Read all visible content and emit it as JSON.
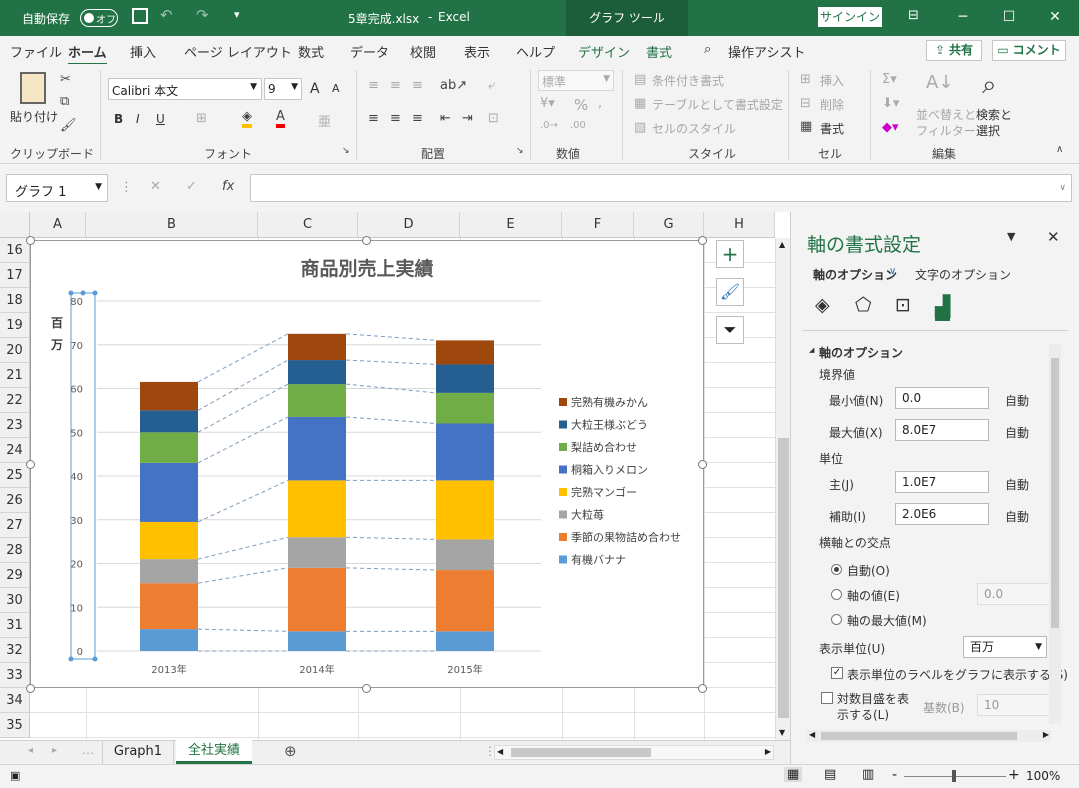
{
  "titlebar": {
    "autosave": "自動保存",
    "toggle": "オフ",
    "filename": "5章完成.xlsx",
    "sep": "-",
    "app": "Excel",
    "context_tab": "グラフ ツール",
    "signin": "サインイン",
    "minimize": "─",
    "restore": "☐",
    "close": "✕"
  },
  "tabs": [
    "ファイル",
    "ホーム",
    "挿入",
    "ページ レイアウト",
    "数式",
    "データ",
    "校閲",
    "表示",
    "ヘルプ",
    "デザイン",
    "書式"
  ],
  "tell_me": "操作アシスト",
  "share": "共有",
  "comment": "コメント",
  "ribbon": {
    "clipboard": {
      "paste": "貼り付け",
      "label": "クリップボード"
    },
    "font": {
      "name": "Calibri 本文",
      "size": "9",
      "label": "フォント",
      "grow": "A",
      "shrink": "A",
      "bold": "B",
      "italic": "I",
      "underline": "U"
    },
    "alignment": {
      "label": "配置"
    },
    "number": {
      "format": "標準",
      "label": "数値",
      "percent": "%"
    },
    "styles": {
      "conditional": "条件付き書式",
      "table": "テーブルとして書式設定",
      "cell": "セルのスタイル",
      "label": "スタイル"
    },
    "cells": {
      "insert": "挿入",
      "delete": "削除",
      "format": "書式",
      "label": "セル"
    },
    "editing": {
      "sort": "並べ替えと",
      "sort2": "フィルター",
      "find": "検索と",
      "find2": "選択",
      "label": "編集"
    }
  },
  "formula_bar": {
    "name_box": "グラフ 1",
    "fx": "fx",
    "value": ""
  },
  "sheet": {
    "columns": [
      "A",
      "B",
      "C",
      "D",
      "E",
      "F",
      "G",
      "H"
    ],
    "rows": [
      "16",
      "17",
      "18",
      "19",
      "20",
      "21",
      "22",
      "23",
      "24",
      "25",
      "26",
      "27",
      "28",
      "29",
      "30",
      "31",
      "32",
      "33",
      "34",
      "35"
    ]
  },
  "chart_data": {
    "type": "bar",
    "title": "商品別売上実績",
    "ylabel": "百万",
    "ylim": [
      0,
      80
    ],
    "yticks": [
      "0",
      "10",
      "20",
      "30",
      "40",
      "50",
      "60",
      "70",
      "80"
    ],
    "categories": [
      "2013年",
      "2014年",
      "2015年"
    ],
    "series": [
      {
        "name": "有機バナナ",
        "values": [
          5,
          4.5,
          4.5
        ],
        "color": "#5b9bd5"
      },
      {
        "name": "季節の果物詰め合わせ",
        "values": [
          10.5,
          14.5,
          14
        ],
        "color": "#ed7d31"
      },
      {
        "name": "大粒苺",
        "values": [
          5.5,
          7,
          7
        ],
        "color": "#a5a5a5"
      },
      {
        "name": "完熟マンゴー",
        "values": [
          8.5,
          13,
          13.5
        ],
        "color": "#ffc000"
      },
      {
        "name": "桐箱入りメロン",
        "values": [
          13.5,
          14.5,
          13
        ],
        "color": "#4472c4"
      },
      {
        "name": "梨詰め合わせ",
        "values": [
          7,
          7.5,
          7
        ],
        "color": "#70ad47"
      },
      {
        "name": "大粒王様ぶどう",
        "values": [
          5,
          5.5,
          6.5
        ],
        "color": "#255e91"
      },
      {
        "name": "完熟有機みかん",
        "values": [
          6.5,
          6,
          5.5
        ],
        "color": "#9e480e"
      }
    ],
    "grid": true,
    "legend": "right"
  },
  "sheet_tabs": [
    "Graph1",
    "全社実績"
  ],
  "status": {
    "zoom": "100%",
    "minus": "-",
    "plus": "+"
  },
  "pane": {
    "title": "軸の書式設定",
    "tab_axis": "軸のオプション",
    "tab_text": "文字のオプション",
    "section": "軸のオプション",
    "bounds": "境界値",
    "min_label": "最小値(N)",
    "min_value": "0.0",
    "min_auto": "自動",
    "max_label": "最大値(X)",
    "max_value": "8.0E7",
    "max_auto": "自動",
    "units": "単位",
    "major_label": "主(J)",
    "major_value": "1.0E7",
    "major_auto": "自動",
    "minor_label": "補助(I)",
    "minor_value": "2.0E6",
    "minor_auto": "自動",
    "cross": "横軸との交点",
    "r_auto": "自動(O)",
    "r_value": "軸の値(E)",
    "r_value_v": "0.0",
    "r_max": "軸の最大値(M)",
    "display_units": "表示単位(U)",
    "display_units_v": "百万",
    "show_label": "表示単位のラベルをグラフに表示する(S)",
    "log": "対数目盛を表",
    "log2": "示する(L)",
    "base": "基数(B)",
    "base_v": "10"
  }
}
